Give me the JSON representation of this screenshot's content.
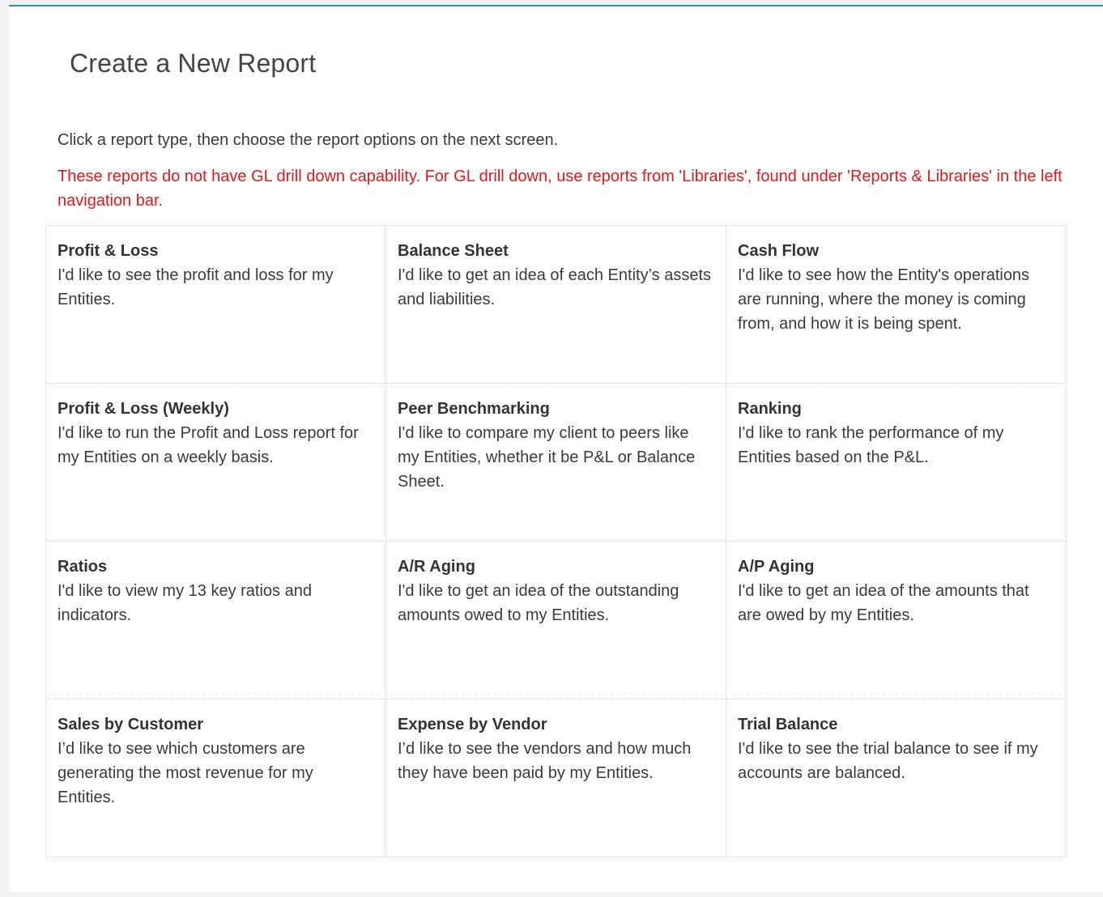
{
  "page": {
    "title": "Create a New Report",
    "intro": "Click a report type, then choose the report options on the next screen.",
    "warning": "These reports do not have GL drill down capability. For GL drill down, use reports from 'Libraries', found under 'Reports & Libraries' in the left navigation bar."
  },
  "colors": {
    "accent_rule": "#2f8fc4",
    "warning_text": "#e8161b",
    "background": "#f2f2f2",
    "panel": "#ffffff"
  },
  "reports": [
    {
      "title": "Profit & Loss",
      "description": "I'd like to see the profit and loss for my Entities."
    },
    {
      "title": "Balance Sheet",
      "description": "I'd like to get an idea of each Entity’s assets and liabilities."
    },
    {
      "title": "Cash Flow",
      "description": "I'd like to see how the Entity's operations are running, where the money is coming from, and how it is being spent."
    },
    {
      "title": "Profit & Loss (Weekly)",
      "description": "I'd like to run the Profit and Loss report for my Entities on a weekly basis."
    },
    {
      "title": "Peer Benchmarking",
      "description": "I'd like to compare my client to peers like my Entities, whether it be P&L or Balance Sheet."
    },
    {
      "title": "Ranking",
      "description": "I'd like to rank the performance of my Entities based on the P&L."
    },
    {
      "title": "Ratios",
      "description": "I'd like to view my 13 key ratios and indicators."
    },
    {
      "title": "A/R Aging",
      "description": "I'd like to get an idea of the outstanding amounts owed to my Entities."
    },
    {
      "title": "A/P Aging",
      "description": "I'd like to get an idea of the amounts that are owed by my Entities."
    },
    {
      "title": "Sales by Customer",
      "description": "I’d like to see which customers are generating the most revenue for my Entities."
    },
    {
      "title": "Expense by Vendor",
      "description": "I’d like to see the vendors and how much they have been paid by my Entities."
    },
    {
      "title": "Trial Balance",
      "description": "I'd like to see the trial balance to see if my accounts are balanced."
    }
  ]
}
